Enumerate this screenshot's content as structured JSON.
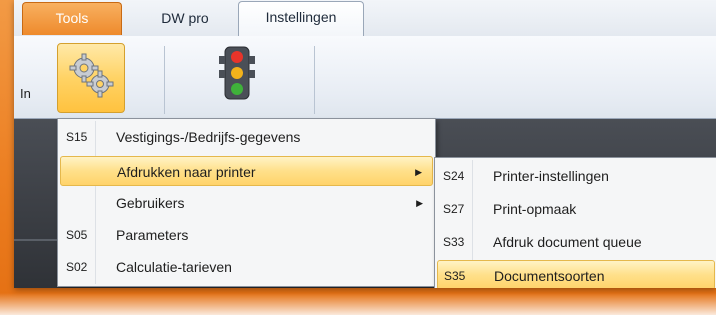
{
  "tabs": [
    {
      "label": "Tools",
      "active": false,
      "highlight": true
    },
    {
      "label": "DW pro",
      "active": false
    },
    {
      "label": "Instellingen",
      "active": true
    }
  ],
  "ribbon": {
    "group_label_partial": "In",
    "buttons": [
      {
        "icon": "gears-icon",
        "pressed": true
      },
      {
        "icon": "traffic-light-icon",
        "pressed": false
      }
    ]
  },
  "menu": {
    "items": [
      {
        "code": "S15",
        "label": "Vestigings-/Bedrijfs-gegevens",
        "submenu": false,
        "highlighted": false
      },
      {
        "code": "",
        "label": "Afdrukken naar printer",
        "submenu": true,
        "highlighted": true
      },
      {
        "code": "",
        "label": "Gebruikers",
        "submenu": true,
        "highlighted": false
      },
      {
        "code": "S05",
        "label": "Parameters",
        "submenu": false,
        "highlighted": false
      },
      {
        "code": "S02",
        "label": "Calculatie-tarieven",
        "submenu": false,
        "highlighted": false
      }
    ]
  },
  "submenu": {
    "items": [
      {
        "code": "S24",
        "label": "Printer-instellingen",
        "highlighted": false
      },
      {
        "code": "S27",
        "label": "Print-opmaak",
        "highlighted": false
      },
      {
        "code": "S33",
        "label": "Afdruk document queue",
        "highlighted": false
      },
      {
        "code": "S35",
        "label": "Documentsoorten",
        "highlighted": true
      }
    ]
  },
  "colors": {
    "frame": "#ec7f22",
    "highlight": "#ffe08a",
    "tools_tab": "#ee8a2c"
  }
}
